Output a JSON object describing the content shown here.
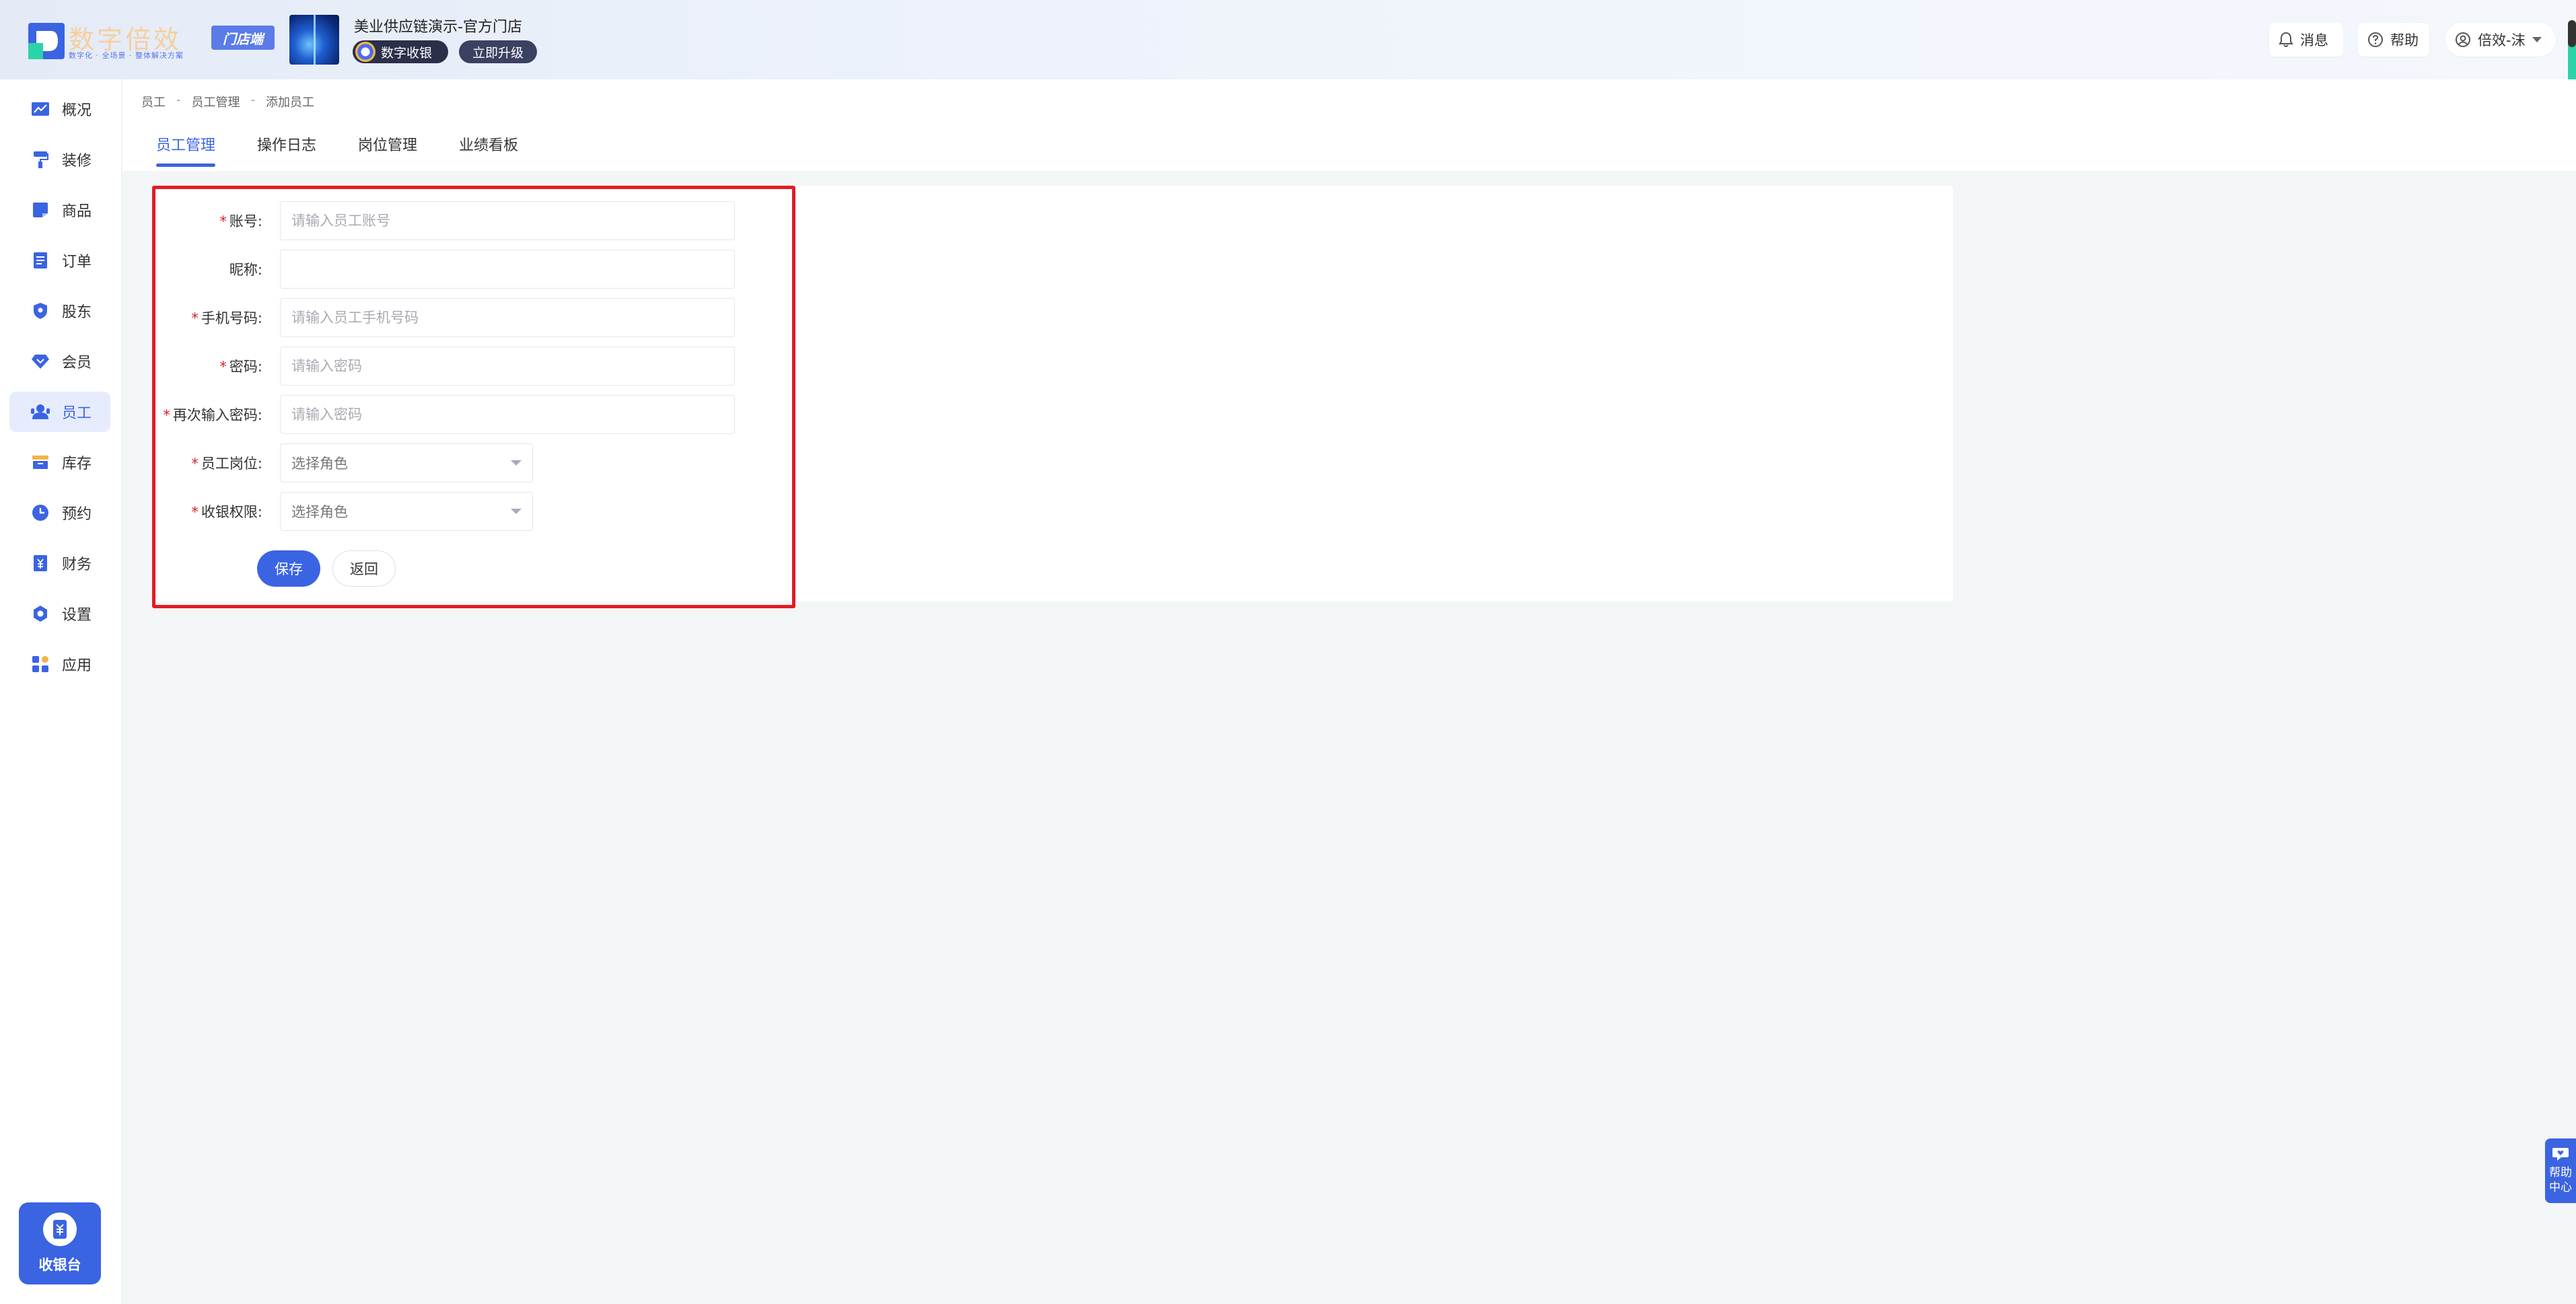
{
  "header": {
    "brand": "数字倍效",
    "slogan": "数字化 · 全场景 · 整体解决方案",
    "store_badge": "门店端",
    "store_name": "美业供应链演示-官方门店",
    "digital_cashier": "数字收银",
    "upgrade": "立即升级",
    "messages": "消息",
    "help": "帮助",
    "user": "倍效-沫"
  },
  "sidebar": {
    "items": [
      {
        "label": "概况",
        "icon": "chart-icon"
      },
      {
        "label": "装修",
        "icon": "paint-roller-icon"
      },
      {
        "label": "商品",
        "icon": "product-icon"
      },
      {
        "label": "订单",
        "icon": "order-icon"
      },
      {
        "label": "股东",
        "icon": "shareholder-icon"
      },
      {
        "label": "会员",
        "icon": "member-icon"
      },
      {
        "label": "员工",
        "icon": "staff-icon",
        "active": true
      },
      {
        "label": "库存",
        "icon": "inventory-icon"
      },
      {
        "label": "预约",
        "icon": "clock-icon"
      },
      {
        "label": "财务",
        "icon": "finance-icon"
      },
      {
        "label": "设置",
        "icon": "gear-icon"
      },
      {
        "label": "应用",
        "icon": "apps-icon"
      }
    ],
    "cashier": "收银台"
  },
  "breadcrumb": [
    "员工",
    "员工管理",
    "添加员工"
  ],
  "tabs": [
    "员工管理",
    "操作日志",
    "岗位管理",
    "业绩看板"
  ],
  "form": {
    "account_label": "账号:",
    "account_placeholder": "请输入员工账号",
    "nickname_label": "昵称:",
    "nickname_placeholder": "",
    "phone_label": "手机号码:",
    "phone_placeholder": "请输入员工手机号码",
    "password_label": "密码:",
    "password_placeholder": "请输入密码",
    "password2_label": "再次输入密码:",
    "password2_placeholder": "请输入密码",
    "position_label": "员工岗位:",
    "position_value": "选择角色",
    "cashier_perm_label": "收银权限:",
    "cashier_perm_value": "选择角色",
    "save": "保存",
    "back": "返回"
  },
  "help_float": [
    "帮助",
    "中心"
  ],
  "colors": {
    "accent": "#3b64e2",
    "required": "#e02020",
    "highlight": "#e31b23"
  }
}
